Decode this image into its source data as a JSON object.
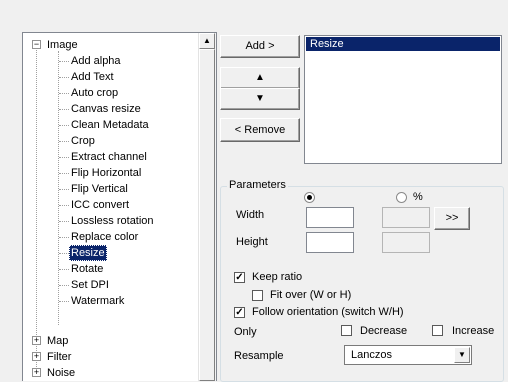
{
  "tree": {
    "items": [
      {
        "label": "Image",
        "expander": "−"
      },
      {
        "label": "Add alpha"
      },
      {
        "label": "Add Text"
      },
      {
        "label": "Auto crop"
      },
      {
        "label": "Canvas resize"
      },
      {
        "label": "Clean Metadata"
      },
      {
        "label": "Crop"
      },
      {
        "label": "Extract channel"
      },
      {
        "label": "Flip Horizontal"
      },
      {
        "label": "Flip Vertical"
      },
      {
        "label": "ICC convert"
      },
      {
        "label": "Lossless rotation"
      },
      {
        "label": "Replace color"
      },
      {
        "label": "Resize",
        "selected": true
      },
      {
        "label": "Rotate"
      },
      {
        "label": "Set DPI"
      },
      {
        "label": "Watermark"
      },
      {
        "label": "Map",
        "expander": "+"
      },
      {
        "label": "Filter",
        "expander": "+"
      },
      {
        "label": "Noise",
        "expander": "+"
      }
    ]
  },
  "scrollbar": {
    "up_icon": "▲"
  },
  "buttons": {
    "add": "Add >",
    "move_up": "▲",
    "move_down": "▼",
    "remove": "< Remove",
    "ratio": ">>"
  },
  "operations": {
    "items": [
      "Resize"
    ]
  },
  "parameters": {
    "legend": "Parameters",
    "percent_label": "%",
    "width_label": "Width",
    "height_label": "Height",
    "width_value": "",
    "height_value": "",
    "keep_ratio": "Keep ratio",
    "keep_ratio_checked": true,
    "fit_over": "Fit over (W or H)",
    "fit_over_checked": false,
    "follow_orientation": "Follow orientation (switch W/H)",
    "follow_orientation_checked": true,
    "only_label": "Only",
    "decrease": "Decrease",
    "increase": "Increase",
    "resample_label": "Resample",
    "resample_value": "Lanczos",
    "check_glyph": "✓",
    "dropdown_icon": "▼"
  },
  "colors": {
    "selection": "#0a246a",
    "background": "#f0f0f0"
  }
}
